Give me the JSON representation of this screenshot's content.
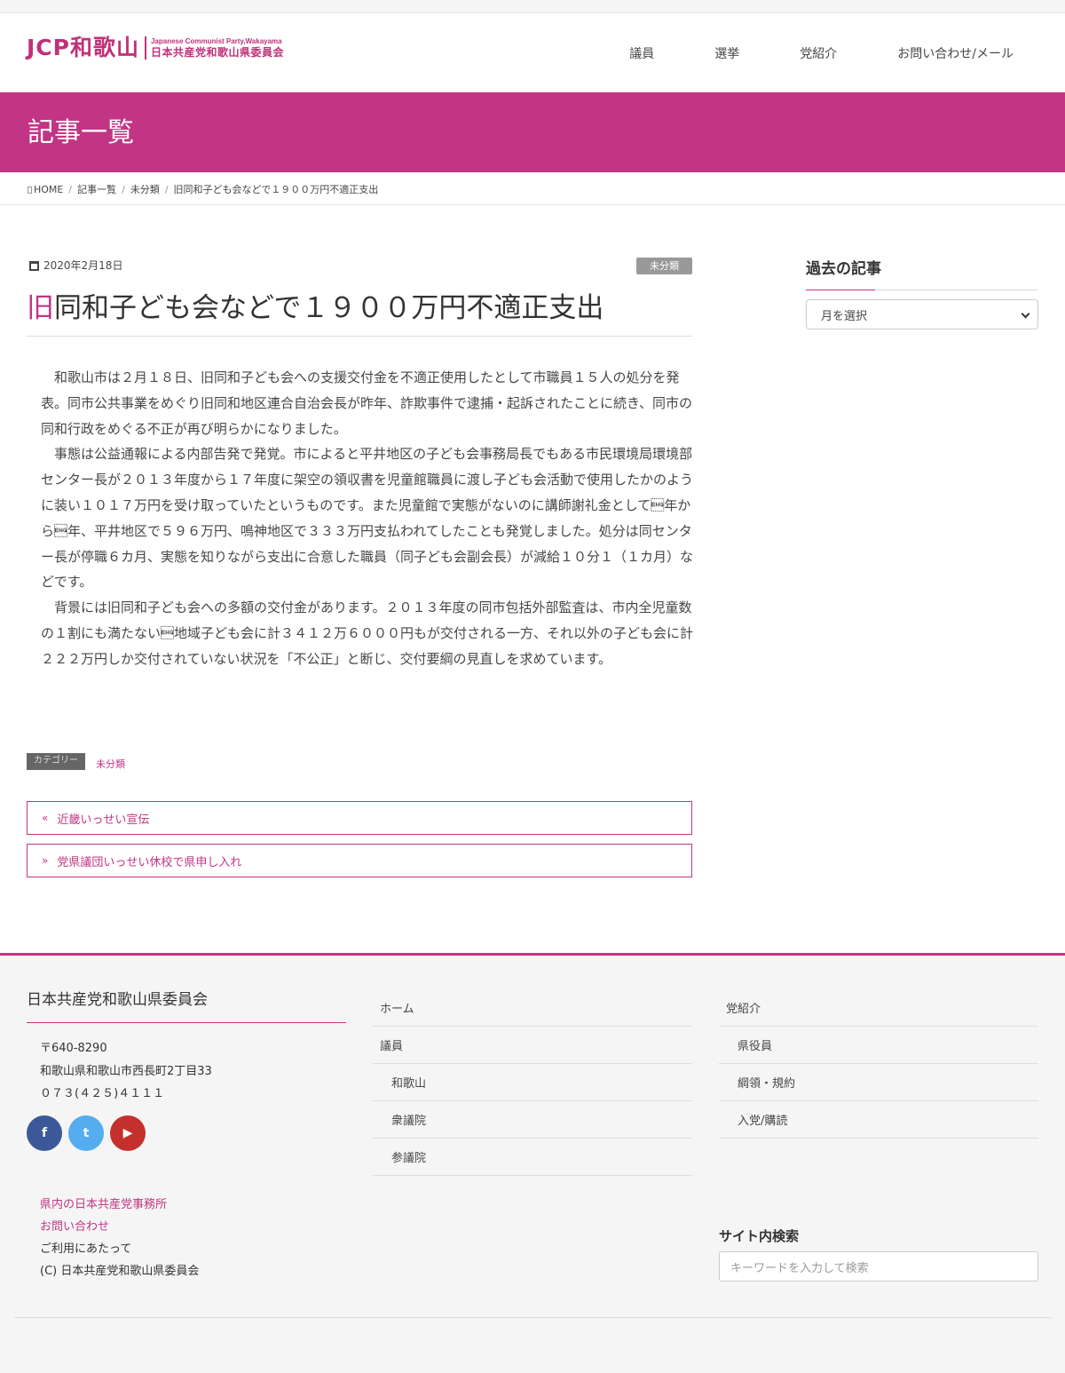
{
  "site": {
    "logo_main": "JCP和歌山",
    "logo_en": "Japanese Communist Party,Wakayama",
    "logo_jp": "日本共産党和歌山県委員会"
  },
  "nav": {
    "items": [
      "議員",
      "選挙",
      "党紹介",
      "お問い合わせ/メール"
    ]
  },
  "page_header": {
    "title": "記事一覧"
  },
  "breadcrumb": {
    "home": "HOME",
    "items": [
      "記事一覧",
      "未分類",
      "旧同和子ども会などで１９００万円不適正支出"
    ]
  },
  "article": {
    "date": "2020年2月18日",
    "category_badge": "未分類",
    "title_first": "旧",
    "title_rest": "同和子ども会などで１９００万円不適正支出",
    "paragraphs": [
      "和歌山市は２月１８日、旧同和子ども会への支援交付金を不適正使用したとして市職員１５人の処分を発表。同市公共事業をめぐり旧同和地区連合自治会長が昨年、詐欺事件で逮捕・起訴されたことに続き、同市の同和行政をめぐる不正が再び明らかになりました。",
      "事態は公益通報による内部告発で発覚。市によると平井地区の子ども会事務局長でもある市民環境局環境部センター長が２０１３年度から１７年度に架空の領収書を児童館職員に渡し子ども会活動で使用したかのように装い１０１７万円を受け取っていたというものです。また児童館で実態がないのに講師謝礼金として\u0005年から\u0005年、平井地区で５９６万円、鳴神地区で３３３万円支払われてしたことも発覚しました。処分は同センター長が停職６カ月、実態を知りながら支出に合意した職員（同子ども会副会長）が減給１０分１（１カ月）などです。",
      "背景には旧同和子ども会への多額の交付金があります。２０１３年度の同市包括外部監査は、市内全児童数の１割にも満たない\u0005地域子ども会に計３４１２万６０００円もが交付される一方、それ以外の子ども会に計２２２万円しか交付されていない状況を「不公正」と断じ、交付要綱の見直しを求めています。"
    ],
    "category_label": "カテゴリー",
    "category_link": "未分類",
    "prev_arrow": "«",
    "prev_title": "近畿いっせい宣伝",
    "next_arrow": "»",
    "next_title": "党県議団いっせい休校で県申し入れ"
  },
  "sidebar": {
    "archive_title": "過去の記事",
    "month_select_placeholder": "月を選択"
  },
  "footer": {
    "org_title": "日本共産党和歌山県委員会",
    "postal": "〒640-8290",
    "address": "和歌山県和歌山市西長町2丁目33",
    "phone": "０７３(４２５)４１１１",
    "social": {
      "facebook": "f",
      "twitter": "t",
      "youtube": "▶"
    },
    "links": [
      "県内の日本共産党事務所",
      "お問い合わせ"
    ],
    "usage": "ご利用にあたって",
    "copyright": "(C) 日本共産党和歌山県委員会",
    "nav_col2": [
      "ホーム",
      "議員",
      "和歌山",
      "衆議院",
      "参議院"
    ],
    "nav_col3": [
      "党紹介",
      "県役員",
      "綱領・規約",
      "入党/購読"
    ],
    "search_title": "サイト内検索",
    "search_placeholder": "キーワードを入力して検索"
  }
}
